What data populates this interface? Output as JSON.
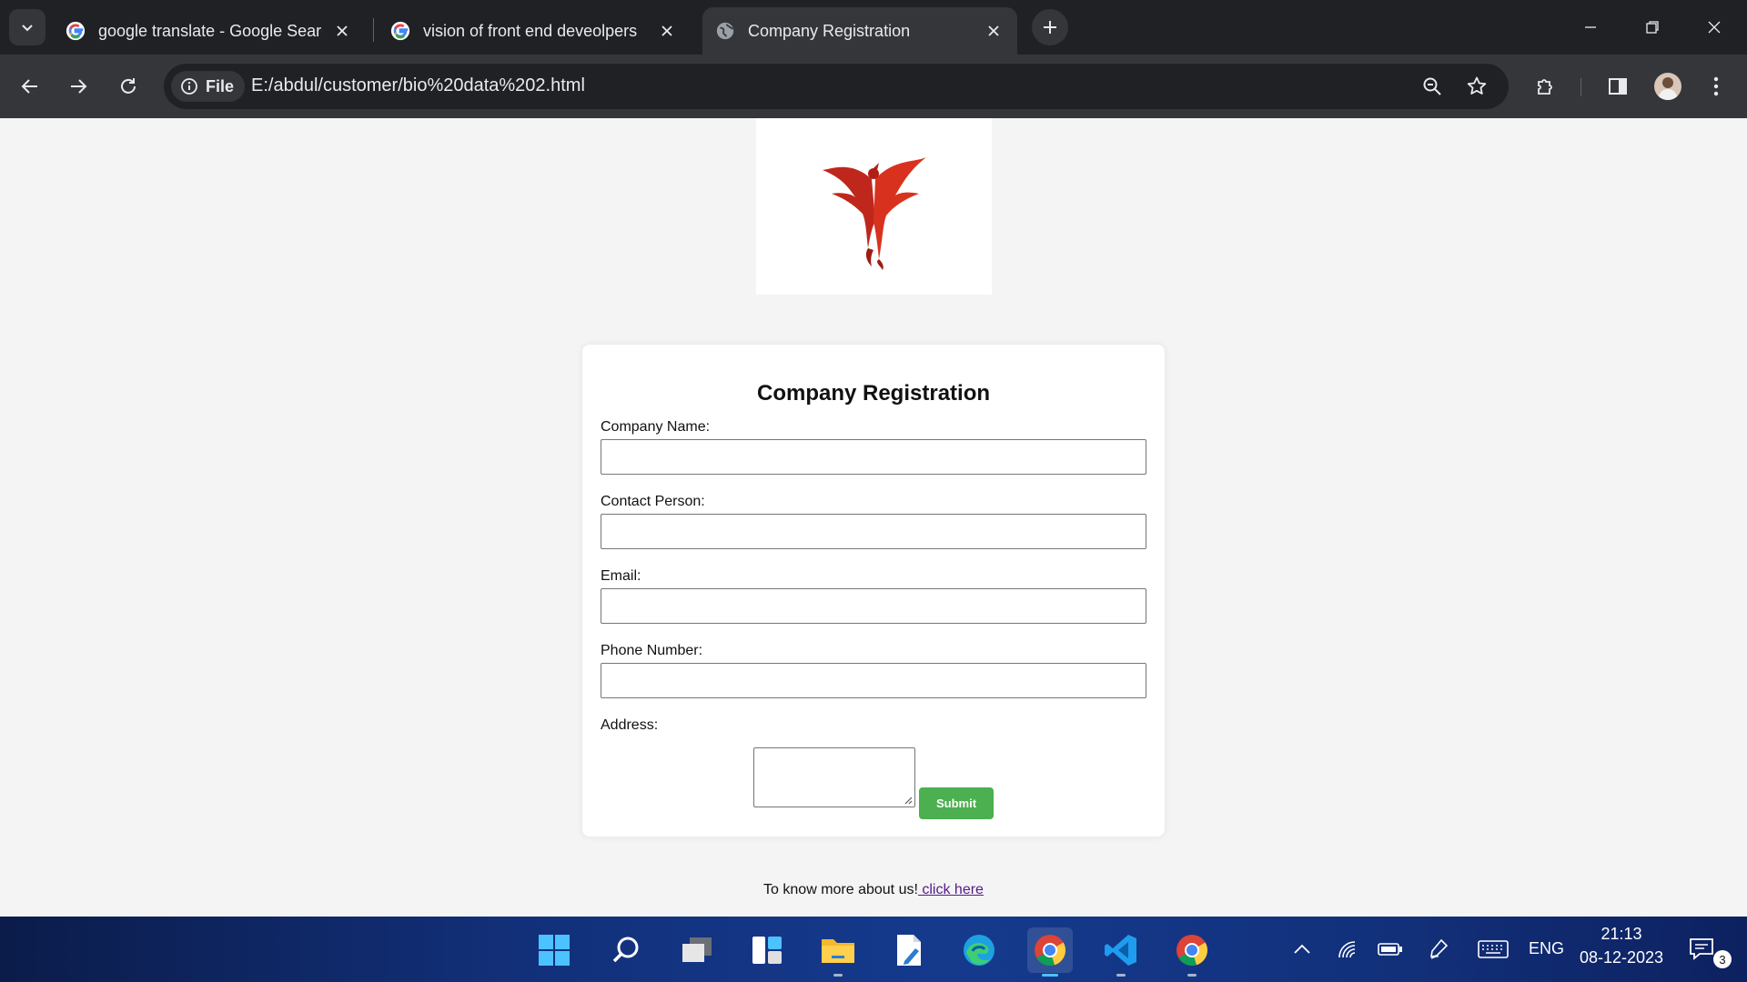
{
  "browser": {
    "tabs": [
      {
        "title": "google translate - Google Search",
        "favicon": "google-g-icon",
        "active": false
      },
      {
        "title": "vision of front end deveolpers",
        "favicon": "google-g-icon",
        "active": false
      },
      {
        "title": "Company Registration",
        "favicon": "globe-icon",
        "active": true
      }
    ],
    "site_chip_label": "File",
    "url": "E:/abdul/customer/bio%20data%202.html"
  },
  "page": {
    "logo": "phoenix-logo",
    "form": {
      "title": "Company Registration",
      "fields": [
        {
          "label": "Company Name:",
          "value": ""
        },
        {
          "label": "Contact Person:",
          "value": ""
        },
        {
          "label": "Email:",
          "value": ""
        },
        {
          "label": "Phone Number:",
          "value": ""
        }
      ],
      "address_label": "Address:",
      "address_value": "",
      "submit_label": "Submit",
      "submit_color": "#4caf50"
    },
    "footer": {
      "text": "To know more about us!",
      "link_text": " click here"
    }
  },
  "taskbar": {
    "language": "ENG",
    "time": "21:13",
    "date": "08-12-2023",
    "notification_count": "3"
  }
}
